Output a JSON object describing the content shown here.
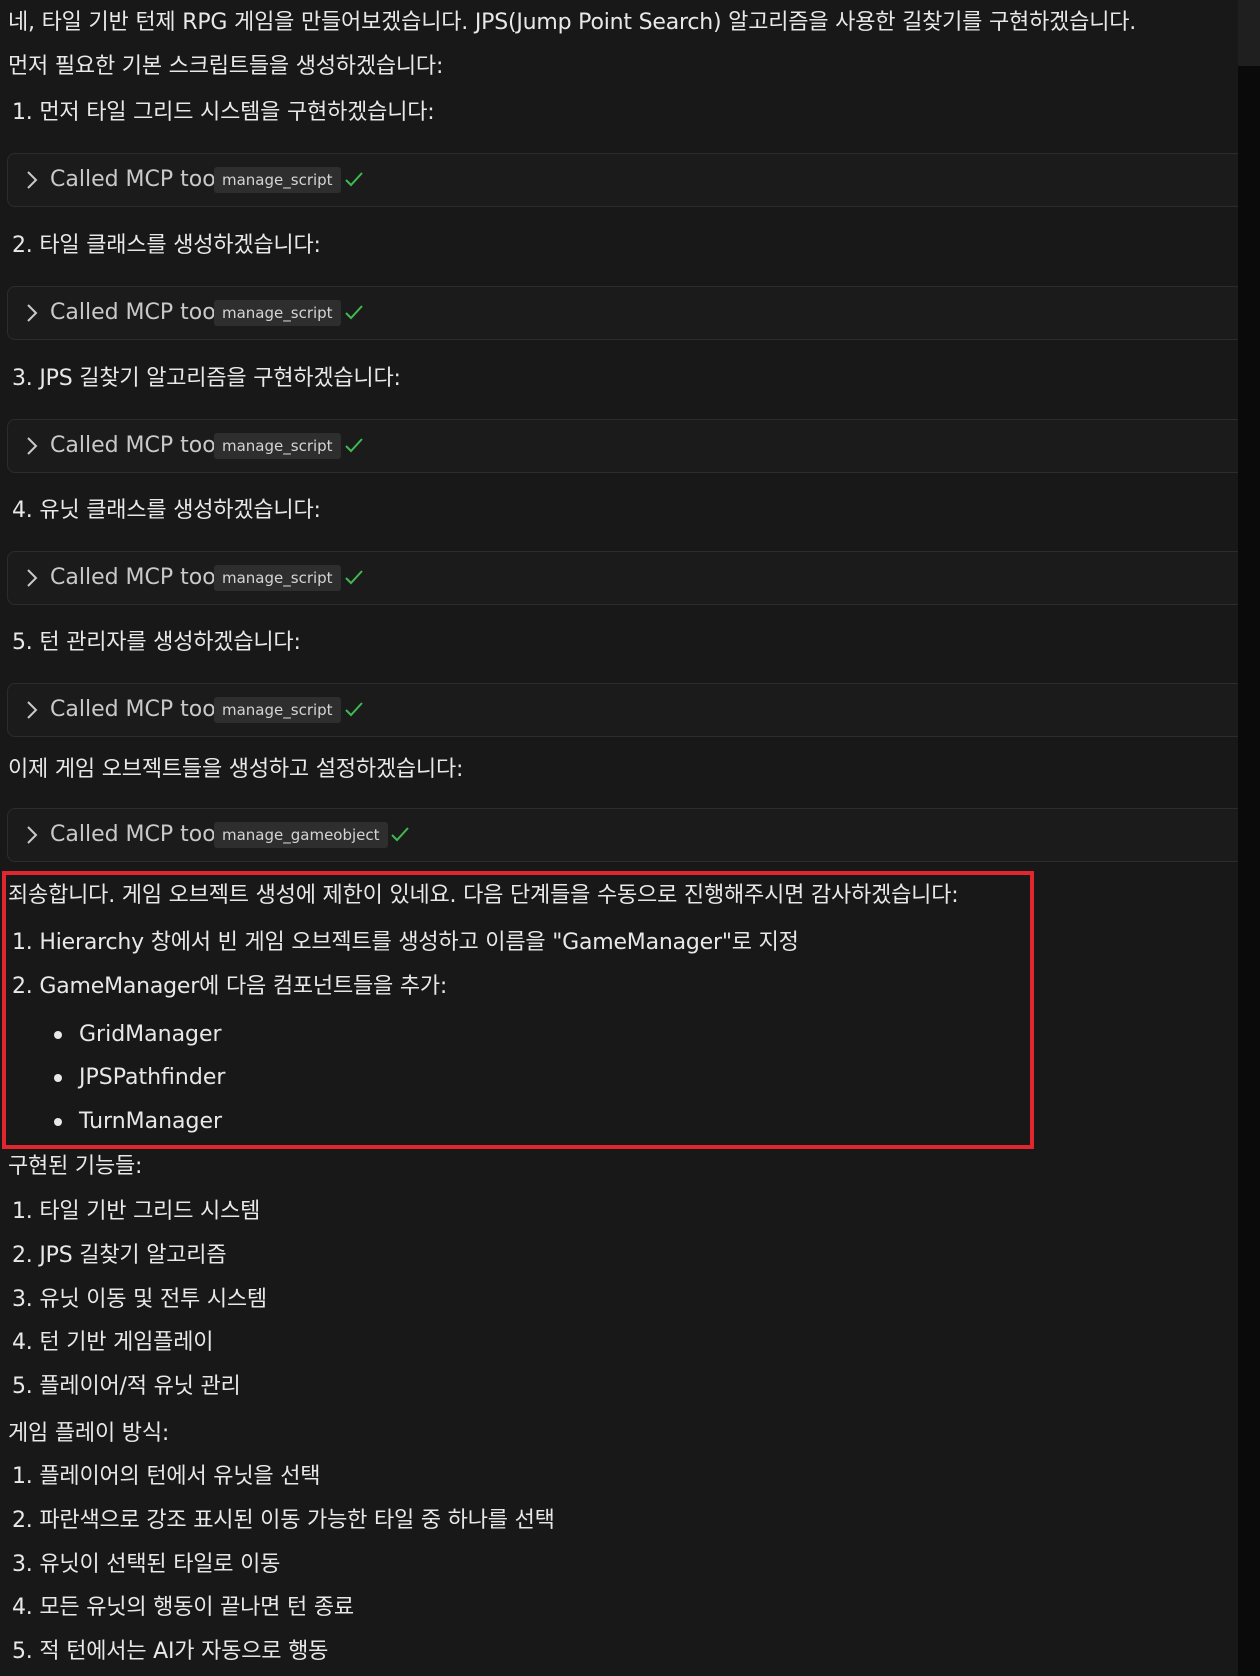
{
  "intro": {
    "line1": "네, 타일 기반 턴제 RPG 게임을 만들어보겠습니다. JPS(Jump Point Search) 알고리즘을 사용한 길찾기를 구현하겠습니다.",
    "line2": "먼저 필요한 기본 스크립트들을 생성하겠습니다:"
  },
  "steps": [
    {
      "text": "1. 먼저 타일 그리드 시스템을 구현하겠습니다:"
    },
    {
      "text": "2. 타일 클래스를 생성하겠습니다:"
    },
    {
      "text": "3. JPS 길찾기 알고리즘을 구현하겠습니다:"
    },
    {
      "text": "4. 유닛 클래스를 생성하겠습니다:"
    },
    {
      "text": "5. 턴 관리자를 생성하겠습니다:"
    }
  ],
  "tool_calls": [
    {
      "label": "Called MCP tool",
      "tool": "manage_script",
      "status_icon": "check-icon"
    },
    {
      "label": "Called MCP tool",
      "tool": "manage_script",
      "status_icon": "check-icon"
    },
    {
      "label": "Called MCP tool",
      "tool": "manage_script",
      "status_icon": "check-icon"
    },
    {
      "label": "Called MCP tool",
      "tool": "manage_script",
      "status_icon": "check-icon"
    },
    {
      "label": "Called MCP tool",
      "tool": "manage_script",
      "status_icon": "check-icon"
    },
    {
      "label": "Called MCP tool",
      "tool": "manage_gameobject",
      "status_icon": "check-icon"
    }
  ],
  "gameobject_intro": "이제 게임 오브젝트들을 생성하고 설정하겠습니다:",
  "notice": {
    "title": "죄송합니다. 게임 오브젝트 생성에 제한이 있네요. 다음 단계들을 수동으로 진행해주시면 감사하겠습니다:",
    "items": [
      "1. Hierarchy 창에서 빈 게임 오브젝트를 생성하고 이름을 \"GameManager\"로 지정",
      "2. GameManager에 다음 컴포넌트들을 추가:"
    ],
    "components": [
      "GridManager",
      "JPSPathfinder",
      "TurnManager"
    ]
  },
  "features": {
    "title": "구현된 기능들:",
    "items": [
      "1. 타일 기반 그리드 시스템",
      "2. JPS 길찾기 알고리즘",
      "3. 유닛 이동 및 전투 시스템",
      "4. 턴 기반 게임플레이",
      "5. 플레이어/적 유닛 관리"
    ]
  },
  "gameplay": {
    "title": "게임 플레이 방식:",
    "items": [
      "1. 플레이어의 턴에서 유닛을 선택",
      "2. 파란색으로 강조 표시된 이동 가능한 타일 중 하나를 선택",
      "3. 유닛이 선택된 타일로 이동",
      "4. 모든 유닛의 행동이 끝나면 턴 종료",
      "5. 적 턴에서는 AI가 자동으로 행동"
    ]
  },
  "colors": {
    "background": "#181818",
    "text": "#e8e8e8",
    "tool_call_bg": "#1b1b1b",
    "chip_bg": "#2e2e2e",
    "check": "#3fb950",
    "highlight_border": "#e0262e"
  }
}
